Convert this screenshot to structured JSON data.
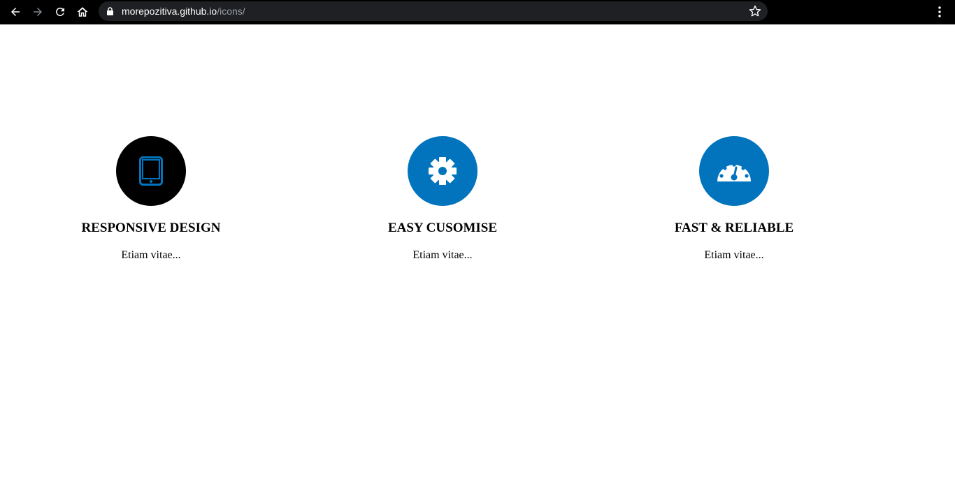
{
  "browser": {
    "url_host": "morepozitiva.github.io",
    "url_path": "/icons/",
    "back_icon": "arrow-left-icon",
    "forward_icon": "arrow-right-icon",
    "reload_icon": "reload-icon",
    "home_icon": "home-icon",
    "lock_icon": "lock-icon",
    "bookmark_icon": "star-icon",
    "menu_icon": "kebab-menu-icon"
  },
  "features": [
    {
      "icon": "tablet-icon",
      "circle_color": "#000000",
      "icon_color": "#0274be",
      "title": "RESPONSIVE DESIGN",
      "text": "Etiam vitae..."
    },
    {
      "icon": "gear-icon",
      "circle_color": "#0274be",
      "icon_color": "#ffffff",
      "title": "EASY CUSOMISE",
      "text": "Etiam vitae..."
    },
    {
      "icon": "speedometer-icon",
      "circle_color": "#0274be",
      "icon_color": "#ffffff",
      "title": "FAST & RELIABLE",
      "text": "Etiam vitae..."
    }
  ]
}
